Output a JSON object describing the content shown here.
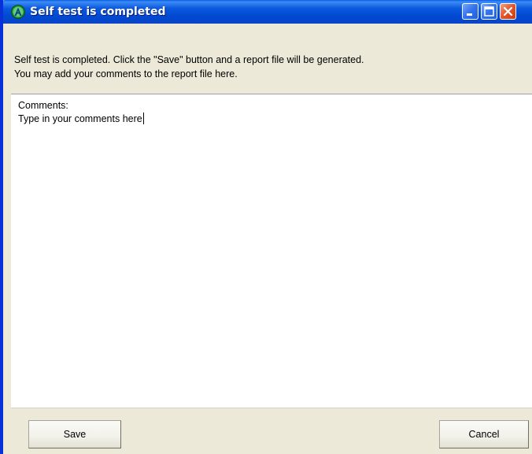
{
  "window": {
    "title": "Self test is completed",
    "icon": "app-a-icon"
  },
  "titlebar_buttons": {
    "minimize_icon": "minimize-icon",
    "maximize_icon": "maximize-icon",
    "close_icon": "close-icon"
  },
  "info": {
    "line1": "Self test is completed. Click the \"Save\" button and a report file will be generated.",
    "line2": "You may add your comments to the report file here."
  },
  "comments": {
    "label": "Comments:",
    "value": "Type in your comments here"
  },
  "buttons": {
    "save": "Save",
    "cancel": "Cancel"
  },
  "colors": {
    "titlebar": "#0048d2",
    "dialog_bg": "#ece9d8",
    "close_button": "#e0552a"
  }
}
